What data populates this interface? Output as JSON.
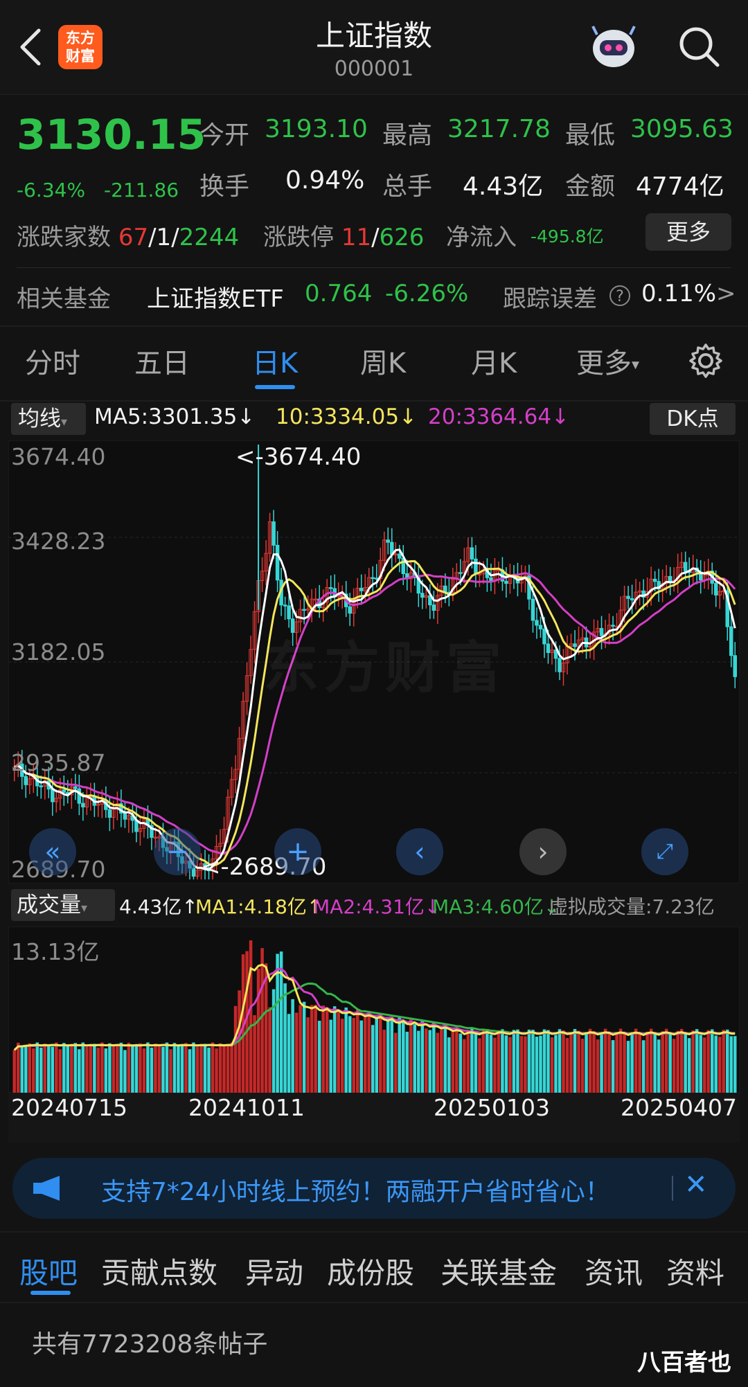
{
  "header": {
    "title": "上证指数",
    "code": "000001",
    "logo_line1": "东方",
    "logo_line2": "财富",
    "back_icon": "chevron-left-icon",
    "search_icon": "search-icon"
  },
  "quote": {
    "price": "3130.15",
    "change_pct": "-6.34%",
    "change": "-211.86",
    "open_label": "今开",
    "open": "3193.10",
    "high_label": "最高",
    "high": "3217.78",
    "low_label": "最低",
    "low": "3095.63",
    "turnover_label": "换手",
    "turnover": "0.94%",
    "volume_label": "总手",
    "volume": "4.43亿",
    "amount_label": "金额",
    "amount": "4774亿",
    "breadth_label": "涨跌家数",
    "up": "67",
    "sep1": "/",
    "flat": "1",
    "sep2": "/",
    "down": "2244",
    "limit_label": "涨跌停",
    "limit_up": "11",
    "sep3": "/",
    "limit_down": "626",
    "netflow_label": "净流入",
    "netflow": "-495.8亿",
    "more_button": "更多"
  },
  "fund": {
    "label": "相关基金",
    "name": "上证指数ETF",
    "price": "0.764",
    "change": "-6.26%",
    "tracking_label": "跟踪误差",
    "tracking": "0.11%",
    "arrow": ">"
  },
  "tabs": [
    {
      "label": "分时"
    },
    {
      "label": "五日"
    },
    {
      "label": "日K"
    },
    {
      "label": "周K"
    },
    {
      "label": "月K"
    },
    {
      "label": "更多"
    }
  ],
  "active_tab": "日K",
  "ma_bar": {
    "selector": "均线",
    "ma5": "MA5:3301.35↓",
    "ma10": "10:3334.05↓",
    "ma20": "20:3364.64↓",
    "dk": "DK点"
  },
  "price_axis": [
    "3674.40",
    "3428.23",
    "3182.05",
    "2935.87",
    "2689.70"
  ],
  "annotations": {
    "high": "<-3674.40",
    "low": "<-2689.70"
  },
  "vol_bar": {
    "selector": "成交量",
    "vol": "4.43亿↑",
    "ma1": "MA1:4.18亿↑",
    "ma2": "MA2:4.31亿↓",
    "ma3": "MA3:4.60亿↓",
    "virtual": "虚拟成交量:7.23亿"
  },
  "vol_axis": "13.13亿",
  "dates": [
    "20240715",
    "20241011",
    "20250103",
    "20250407"
  ],
  "watermark": "东方财富",
  "banner": {
    "text": "支持7*24小时线上预约！两融开户省时省心！",
    "close": "✕"
  },
  "bottom_tabs": [
    {
      "label": "股吧"
    },
    {
      "label": "贡献点数"
    },
    {
      "label": "异动"
    },
    {
      "label": "成份股"
    },
    {
      "label": "关联基金"
    },
    {
      "label": "资讯"
    },
    {
      "label": "资料"
    }
  ],
  "posts": "共有7723208条帖子",
  "corner_watermark": "八百者也",
  "colors": {
    "up": "#e53935",
    "down": "#2fc24a",
    "accent": "#2f8ef0",
    "ma5": "#ffffff",
    "ma10": "#f4e65c",
    "ma20": "#d43fc8",
    "vol_down": "#37d6d6"
  },
  "chart_data": {
    "type": "candlestick",
    "ylim": [
      2689.7,
      3674.4
    ],
    "x_ticks": [
      "20240715",
      "20241011",
      "20250103",
      "20250407"
    ],
    "ohlc_shape": [
      2935,
      2925,
      2905,
      2890,
      2880,
      2890,
      2870,
      2860,
      2855,
      2840,
      2825,
      2810,
      2790,
      2770,
      2750,
      2720,
      2700,
      2735,
      2800,
      2950,
      3150,
      3350,
      3500,
      3300,
      3270,
      3300,
      3320,
      3340,
      3330,
      3310,
      3350,
      3380,
      3450,
      3420,
      3370,
      3340,
      3310,
      3340,
      3380,
      3420,
      3390,
      3370,
      3380,
      3370,
      3360,
      3260,
      3200,
      3180,
      3220,
      3230,
      3240,
      3250,
      3290,
      3330,
      3345,
      3350,
      3370,
      3380,
      3400,
      3380,
      3360,
      3340,
      3130
    ],
    "volume": {
      "max": "13.13亿",
      "last": "4.43亿"
    }
  }
}
